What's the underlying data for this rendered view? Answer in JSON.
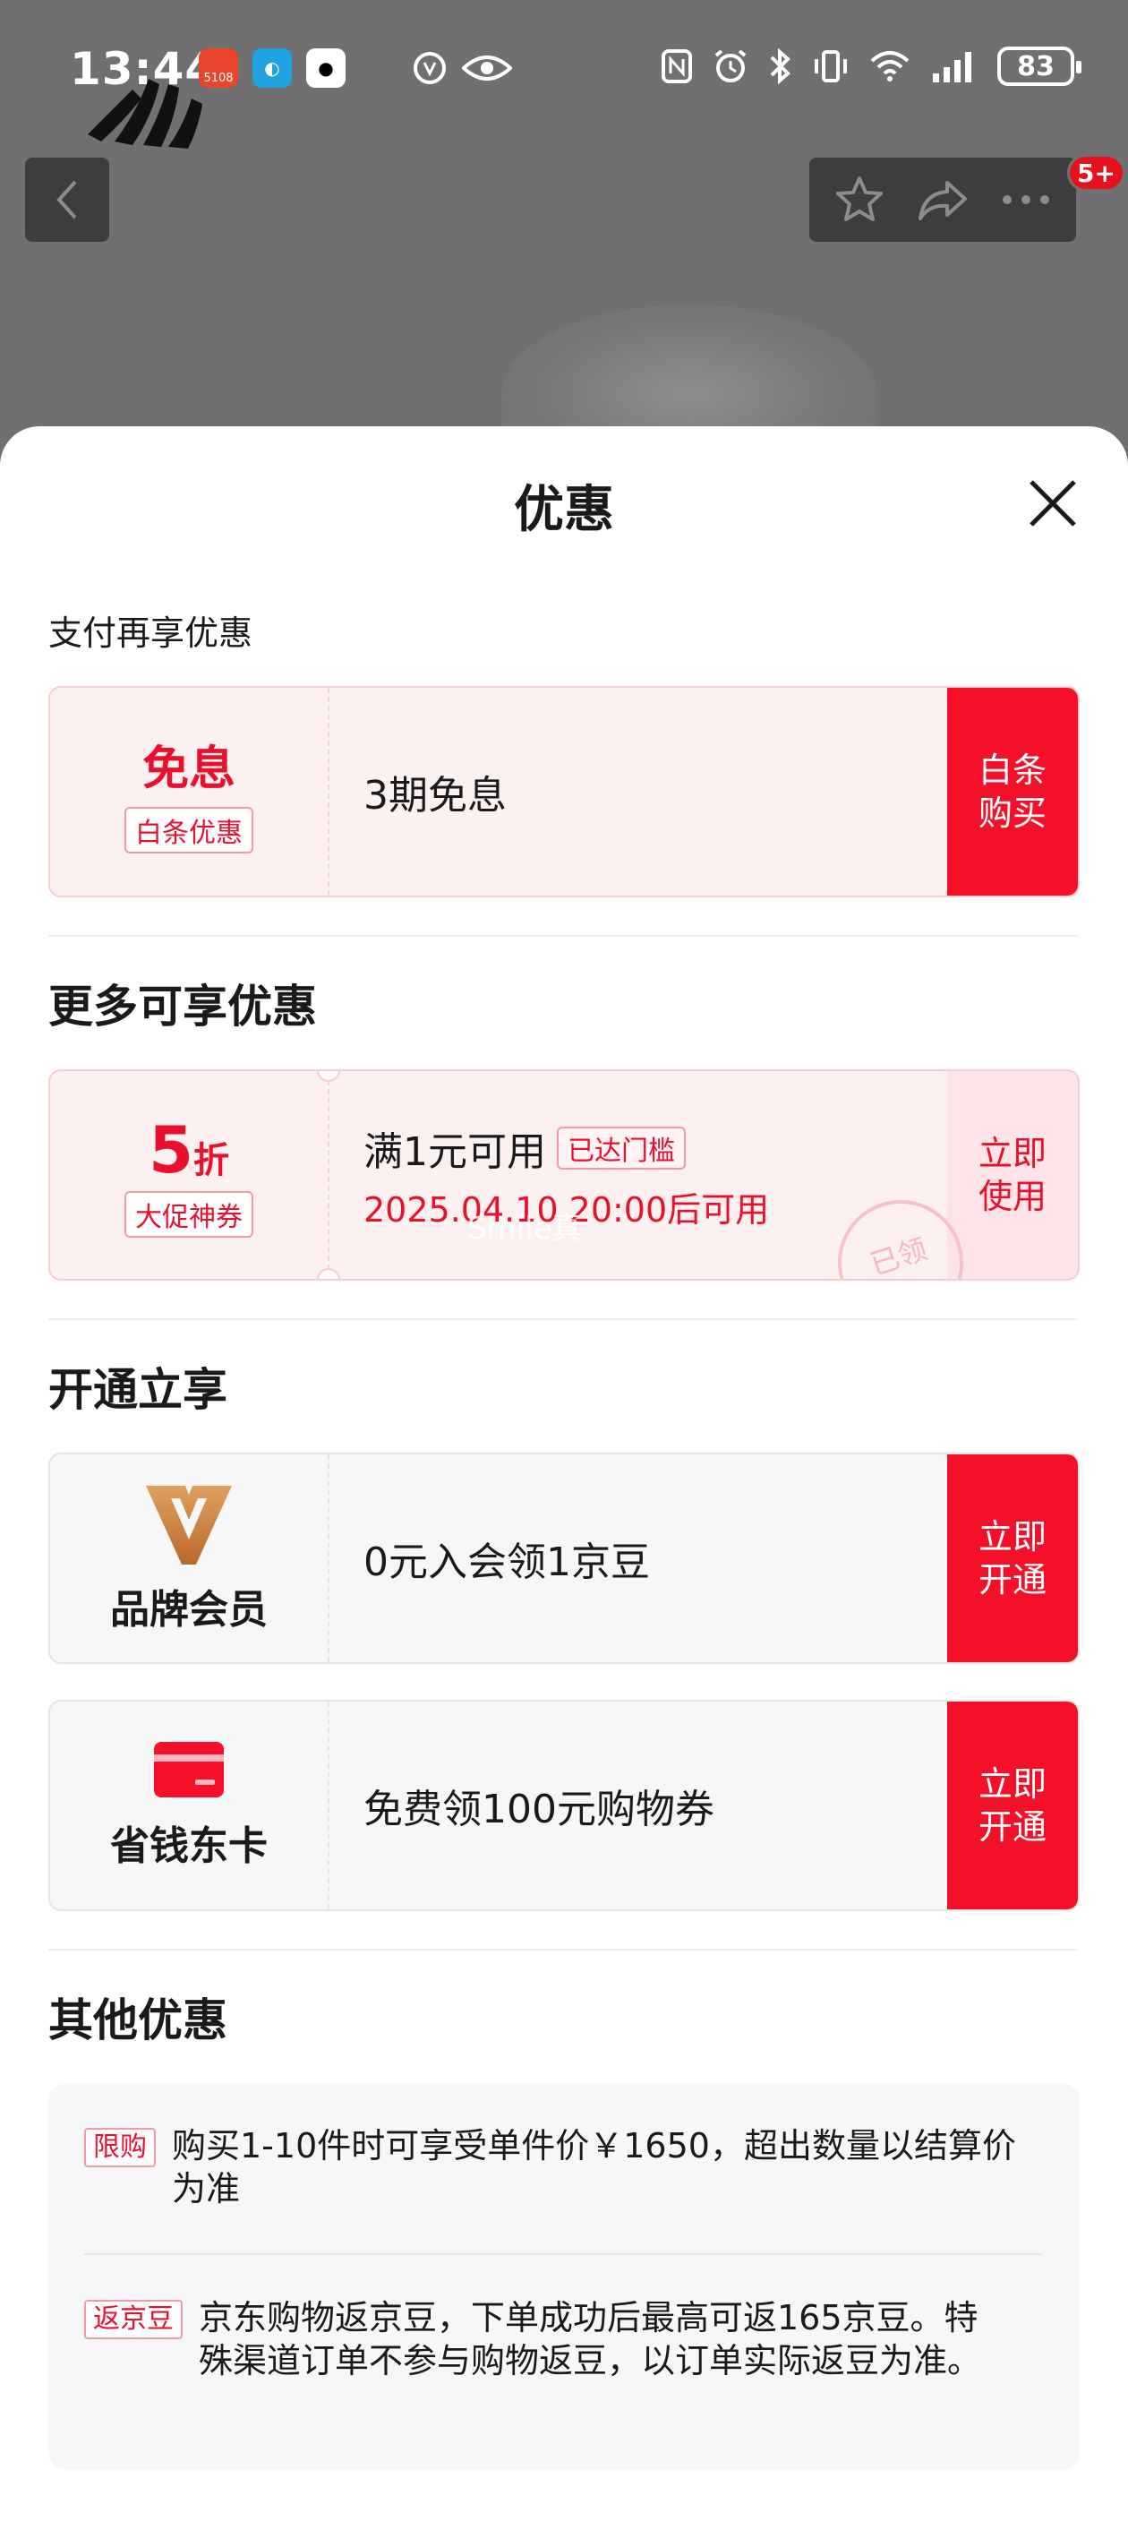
{
  "status_bar": {
    "time": "13:44",
    "battery": "83",
    "apps": [
      {
        "name": "calendar-app",
        "label": "5108",
        "color": "#e8452c"
      },
      {
        "name": "edu-app",
        "label": "◐",
        "color": "#1fa3e0"
      },
      {
        "name": "qq-app",
        "label": "🐧",
        "color": "#ffffff"
      }
    ]
  },
  "top_nav": {
    "cart_badge": "5+"
  },
  "sheet": {
    "title": "优惠",
    "pay_section": {
      "label": "支付再享优惠",
      "card": {
        "main_title": "免息",
        "tag": "白条优惠",
        "description": "3期免息",
        "button_line1": "白条",
        "button_line2": "购买"
      }
    },
    "more_section": {
      "label": "更多可享优惠",
      "card": {
        "discount_number": "5",
        "discount_unit": "折",
        "tag": "大促神券",
        "condition": "满1元可用",
        "reached_tag": "已达门槛",
        "available_time": "2025.04.10 20:00后可用",
        "stamp": "已领",
        "watermark": "Smile真",
        "button_line1": "立即",
        "button_line2": "使用"
      }
    },
    "open_section": {
      "label": "开通立享",
      "brand_member": {
        "name": "品牌会员",
        "description": "0元入会领1京豆",
        "button_line1": "立即",
        "button_line2": "开通"
      },
      "saving_card": {
        "name": "省钱东卡",
        "description": "免费领100元购物券",
        "button_line1": "立即",
        "button_line2": "开通"
      }
    },
    "other_section": {
      "label": "其他优惠",
      "items": [
        {
          "tag": "限购",
          "text": "购买1-10件时可享受单件价￥1650，超出数量以结算价为准"
        },
        {
          "tag": "返京豆",
          "text": "京东购物返京豆，下单成功后最高可返165京豆。特殊渠道订单不参与购物返豆，以订单实际返豆为准。"
        }
      ]
    }
  },
  "colors": {
    "accent_red": "#f5102a",
    "text_red": "#e8102c",
    "gold": "#c8782f"
  }
}
